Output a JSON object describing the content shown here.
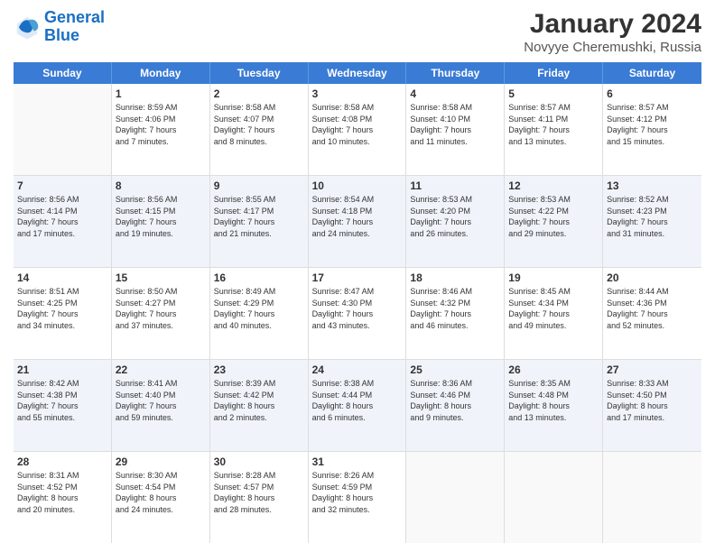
{
  "header": {
    "logo_line1": "General",
    "logo_line2": "Blue",
    "main_title": "January 2024",
    "subtitle": "Novyye Cheremushki, Russia"
  },
  "days_of_week": [
    "Sunday",
    "Monday",
    "Tuesday",
    "Wednesday",
    "Thursday",
    "Friday",
    "Saturday"
  ],
  "weeks": [
    [
      {
        "day": "",
        "info": ""
      },
      {
        "day": "1",
        "info": "Sunrise: 8:59 AM\nSunset: 4:06 PM\nDaylight: 7 hours\nand 7 minutes."
      },
      {
        "day": "2",
        "info": "Sunrise: 8:58 AM\nSunset: 4:07 PM\nDaylight: 7 hours\nand 8 minutes."
      },
      {
        "day": "3",
        "info": "Sunrise: 8:58 AM\nSunset: 4:08 PM\nDaylight: 7 hours\nand 10 minutes."
      },
      {
        "day": "4",
        "info": "Sunrise: 8:58 AM\nSunset: 4:10 PM\nDaylight: 7 hours\nand 11 minutes."
      },
      {
        "day": "5",
        "info": "Sunrise: 8:57 AM\nSunset: 4:11 PM\nDaylight: 7 hours\nand 13 minutes."
      },
      {
        "day": "6",
        "info": "Sunrise: 8:57 AM\nSunset: 4:12 PM\nDaylight: 7 hours\nand 15 minutes."
      }
    ],
    [
      {
        "day": "7",
        "info": "Sunrise: 8:56 AM\nSunset: 4:14 PM\nDaylight: 7 hours\nand 17 minutes."
      },
      {
        "day": "8",
        "info": "Sunrise: 8:56 AM\nSunset: 4:15 PM\nDaylight: 7 hours\nand 19 minutes."
      },
      {
        "day": "9",
        "info": "Sunrise: 8:55 AM\nSunset: 4:17 PM\nDaylight: 7 hours\nand 21 minutes."
      },
      {
        "day": "10",
        "info": "Sunrise: 8:54 AM\nSunset: 4:18 PM\nDaylight: 7 hours\nand 24 minutes."
      },
      {
        "day": "11",
        "info": "Sunrise: 8:53 AM\nSunset: 4:20 PM\nDaylight: 7 hours\nand 26 minutes."
      },
      {
        "day": "12",
        "info": "Sunrise: 8:53 AM\nSunset: 4:22 PM\nDaylight: 7 hours\nand 29 minutes."
      },
      {
        "day": "13",
        "info": "Sunrise: 8:52 AM\nSunset: 4:23 PM\nDaylight: 7 hours\nand 31 minutes."
      }
    ],
    [
      {
        "day": "14",
        "info": "Sunrise: 8:51 AM\nSunset: 4:25 PM\nDaylight: 7 hours\nand 34 minutes."
      },
      {
        "day": "15",
        "info": "Sunrise: 8:50 AM\nSunset: 4:27 PM\nDaylight: 7 hours\nand 37 minutes."
      },
      {
        "day": "16",
        "info": "Sunrise: 8:49 AM\nSunset: 4:29 PM\nDaylight: 7 hours\nand 40 minutes."
      },
      {
        "day": "17",
        "info": "Sunrise: 8:47 AM\nSunset: 4:30 PM\nDaylight: 7 hours\nand 43 minutes."
      },
      {
        "day": "18",
        "info": "Sunrise: 8:46 AM\nSunset: 4:32 PM\nDaylight: 7 hours\nand 46 minutes."
      },
      {
        "day": "19",
        "info": "Sunrise: 8:45 AM\nSunset: 4:34 PM\nDaylight: 7 hours\nand 49 minutes."
      },
      {
        "day": "20",
        "info": "Sunrise: 8:44 AM\nSunset: 4:36 PM\nDaylight: 7 hours\nand 52 minutes."
      }
    ],
    [
      {
        "day": "21",
        "info": "Sunrise: 8:42 AM\nSunset: 4:38 PM\nDaylight: 7 hours\nand 55 minutes."
      },
      {
        "day": "22",
        "info": "Sunrise: 8:41 AM\nSunset: 4:40 PM\nDaylight: 7 hours\nand 59 minutes."
      },
      {
        "day": "23",
        "info": "Sunrise: 8:39 AM\nSunset: 4:42 PM\nDaylight: 8 hours\nand 2 minutes."
      },
      {
        "day": "24",
        "info": "Sunrise: 8:38 AM\nSunset: 4:44 PM\nDaylight: 8 hours\nand 6 minutes."
      },
      {
        "day": "25",
        "info": "Sunrise: 8:36 AM\nSunset: 4:46 PM\nDaylight: 8 hours\nand 9 minutes."
      },
      {
        "day": "26",
        "info": "Sunrise: 8:35 AM\nSunset: 4:48 PM\nDaylight: 8 hours\nand 13 minutes."
      },
      {
        "day": "27",
        "info": "Sunrise: 8:33 AM\nSunset: 4:50 PM\nDaylight: 8 hours\nand 17 minutes."
      }
    ],
    [
      {
        "day": "28",
        "info": "Sunrise: 8:31 AM\nSunset: 4:52 PM\nDaylight: 8 hours\nand 20 minutes."
      },
      {
        "day": "29",
        "info": "Sunrise: 8:30 AM\nSunset: 4:54 PM\nDaylight: 8 hours\nand 24 minutes."
      },
      {
        "day": "30",
        "info": "Sunrise: 8:28 AM\nSunset: 4:57 PM\nDaylight: 8 hours\nand 28 minutes."
      },
      {
        "day": "31",
        "info": "Sunrise: 8:26 AM\nSunset: 4:59 PM\nDaylight: 8 hours\nand 32 minutes."
      },
      {
        "day": "",
        "info": ""
      },
      {
        "day": "",
        "info": ""
      },
      {
        "day": "",
        "info": ""
      }
    ]
  ]
}
